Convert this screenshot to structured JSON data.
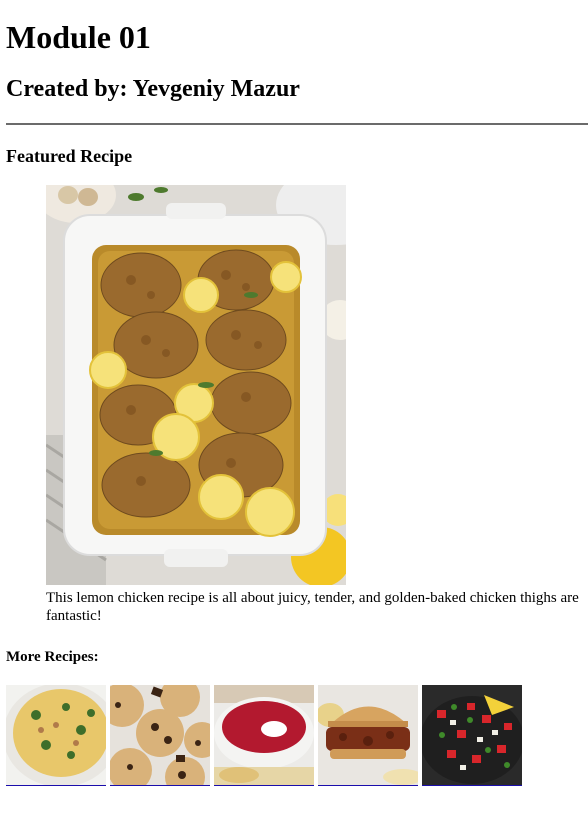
{
  "title": "Module 01",
  "author": "Created by: Yevgeniy Mazur",
  "featured": {
    "heading": "Featured Recipe",
    "image_name": "lemon-chicken-thighs-photo",
    "description": "This lemon chicken recipe is all about juicy, tender, and golden-baked chicken thighs are fantastic!"
  },
  "more": {
    "heading": "More Recipes:",
    "items": [
      {
        "image_name": "creamy-soup-photo"
      },
      {
        "image_name": "chocolate-chip-cookies-photo"
      },
      {
        "image_name": "borscht-photo"
      },
      {
        "image_name": "sloppy-joe-photo"
      },
      {
        "image_name": "pico-de-gallo-photo"
      }
    ]
  }
}
